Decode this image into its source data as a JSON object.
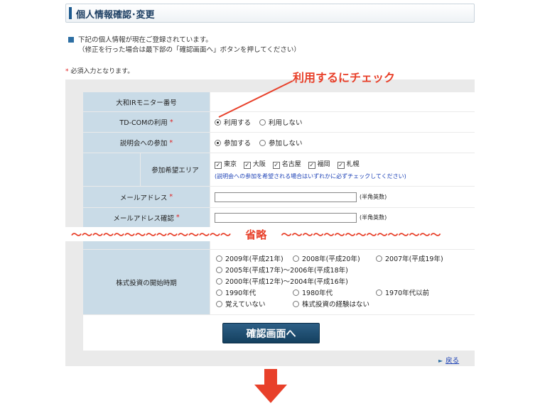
{
  "page": {
    "title": "個人情報確認･変更",
    "intro_line1": "下記の個人情報が現在ご登録されています。",
    "intro_line2": "（修正を行った場合は最下部の「確認画面へ」ボタンを押してください）",
    "required_mark": "*",
    "required_note": "必須入力となります。"
  },
  "annotation": {
    "callout": "利用するにチェック",
    "omitted_label": "〜〜〜〜〜〜〜〜〜〜〜〜〜〜〜　 省略 　〜〜〜〜〜〜〜〜〜〜〜〜〜〜〜"
  },
  "form": {
    "monitor_no_label": "大和IRモニター番号",
    "tdcom_label": "TD-COMの利用",
    "tdcom_options": [
      "利用する",
      "利用しない"
    ],
    "tdcom_selected": "利用する",
    "seminar_label": "説明会への参加",
    "seminar_options": [
      "参加する",
      "参加しない"
    ],
    "seminar_selected": "参加する",
    "area_label": "参加希望エリア",
    "areas": [
      "東京",
      "大阪",
      "名古屋",
      "福岡",
      "札幌"
    ],
    "area_note": "(説明会への参加を希望される場合はいずれかに必ずチェックしてください)",
    "email_label": "メールアドレス",
    "email_value": "",
    "email_hint": "(半角英数)",
    "email_confirm_label": "メールアドレス確認",
    "email_confirm_value": "",
    "email_confirm_hint": "(半角英数)",
    "invest_label": "株式投資の開始時期",
    "invest_options": [
      "2009年(平成21年)",
      "2008年(平成20年)",
      "2007年(平成19年)",
      "2005年(平成17年)～2006年(平成18年)",
      "2000年(平成12年)～2004年(平成16年)",
      "1990年代",
      "1980年代",
      "1970年代以前",
      "覚えていない",
      "株式投資の経験はない"
    ],
    "submit_label": "確認画面へ",
    "back_label": "戻る"
  },
  "colors": {
    "accent": "#1d5a8f",
    "label_bg": "#c9dbe7",
    "annotation_red": "#e8402a",
    "button": "#1f4f73"
  }
}
